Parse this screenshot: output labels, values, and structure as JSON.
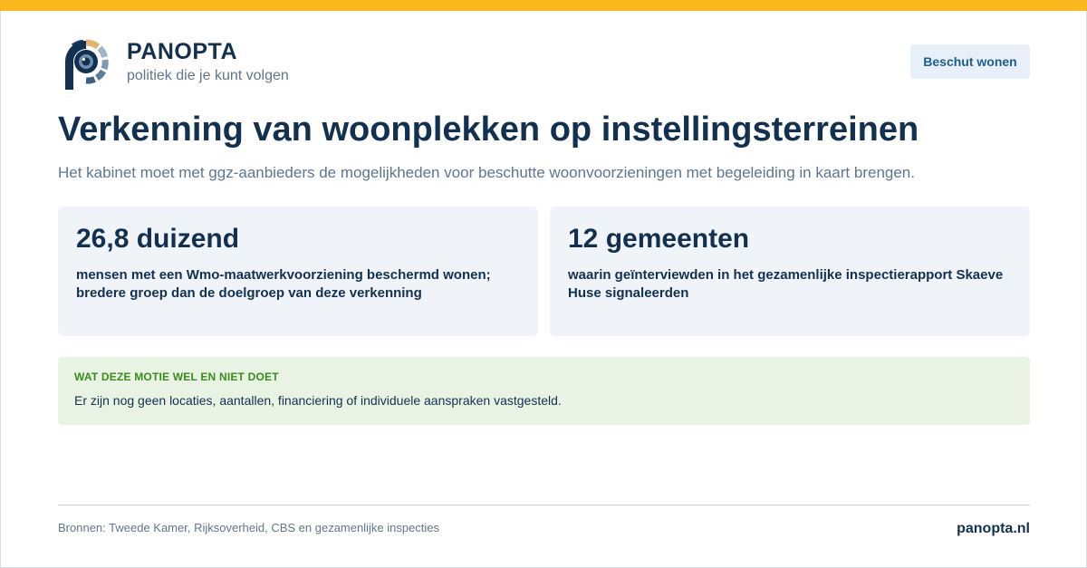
{
  "brand": {
    "name": "PANOPTA",
    "tagline": "politiek die je kunt volgen"
  },
  "header": {
    "tag_label": "Beschut wonen"
  },
  "main": {
    "title": "Verkenning van woonplekken op instellingsterreinen",
    "subtitle": "Het kabinet moet met ggz-aanbieders de mogelijkheden voor beschutte woonvoorzieningen met begeleiding in kaart brengen.",
    "stats": [
      {
        "value": "26,8 duizend",
        "description": "mensen met een Wmo-maatwerkvoorziening beschermd wonen; bredere groep dan de doelgroep van deze verkenning"
      },
      {
        "value": "12 gemeenten",
        "description": "waarin geïnterviewden in het gezamenlijke inspectierapport Skaeve Huse signaleerden"
      }
    ],
    "note": {
      "title": "WAT DEZE MOTIE WEL EN NIET DOET",
      "text": "Er zijn nog geen locaties, aantallen, financiering of individuele aanspraken vastgesteld."
    }
  },
  "footer": {
    "sources": "Bronnen: Tweede Kamer, Rijksoverheid, CBS en gezamenlijke inspecties",
    "site": "panopta.nl"
  },
  "colors": {
    "accent_bar": "#fbb91d",
    "primary_text": "#12304f",
    "muted_text": "#62758a",
    "card_bg": "#f0f4f8",
    "note_bg": "#e8f3e4",
    "note_title": "#3c8a1f",
    "tag_bg": "#e7f0f8",
    "tag_text": "#1d5f8c"
  },
  "icons": {
    "logo": "eye-logo-icon"
  }
}
